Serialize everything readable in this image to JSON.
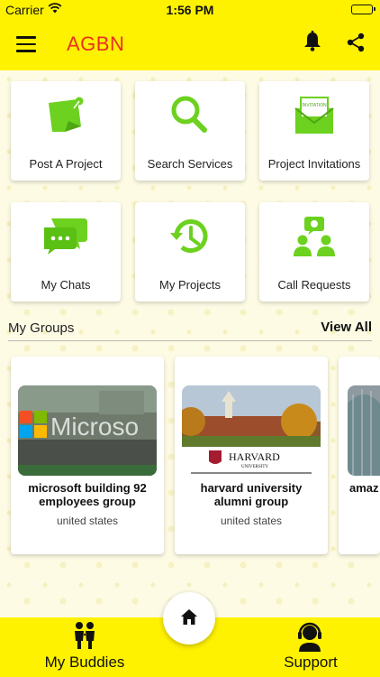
{
  "status_bar": {
    "carrier": "Carrier",
    "time": "1:56 PM",
    "battery_level": 1.0
  },
  "app": {
    "title": "AGBN"
  },
  "icons": {
    "menu": "hamburger-menu-icon",
    "notifications": "bell-icon",
    "share": "share-icon",
    "home": "home-icon",
    "buddies": "people-icon",
    "support": "headset-icon"
  },
  "colors": {
    "accent": "#fff200",
    "brand_title": "#e8321f",
    "icon_green": "#6cd11f"
  },
  "tiles": [
    {
      "label": "Post A Project",
      "icon": "sticky-note-icon"
    },
    {
      "label": "Search Services",
      "icon": "magnifier-icon"
    },
    {
      "label": "Project Invitations",
      "icon": "invitation-envelope-icon",
      "badge": "INVITATION"
    },
    {
      "label": "My Chats",
      "icon": "chat-bubbles-icon"
    },
    {
      "label": "My Projects",
      "icon": "history-clock-icon"
    },
    {
      "label": "Call Requests",
      "icon": "call-request-icon"
    }
  ],
  "groups": {
    "title": "My Groups",
    "view_all": "View All",
    "items": [
      {
        "name": "microsoft building 92 employees group",
        "location": "united states",
        "image_text": "Microso"
      },
      {
        "name": "harvard university alumni group",
        "location": "united states",
        "image_text": "HARVARD",
        "image_subtext": "UNIVERSITY"
      },
      {
        "name": "amaz"
      }
    ]
  },
  "bottom_nav": {
    "buddies_label": "My Buddies",
    "support_label": "Support"
  }
}
